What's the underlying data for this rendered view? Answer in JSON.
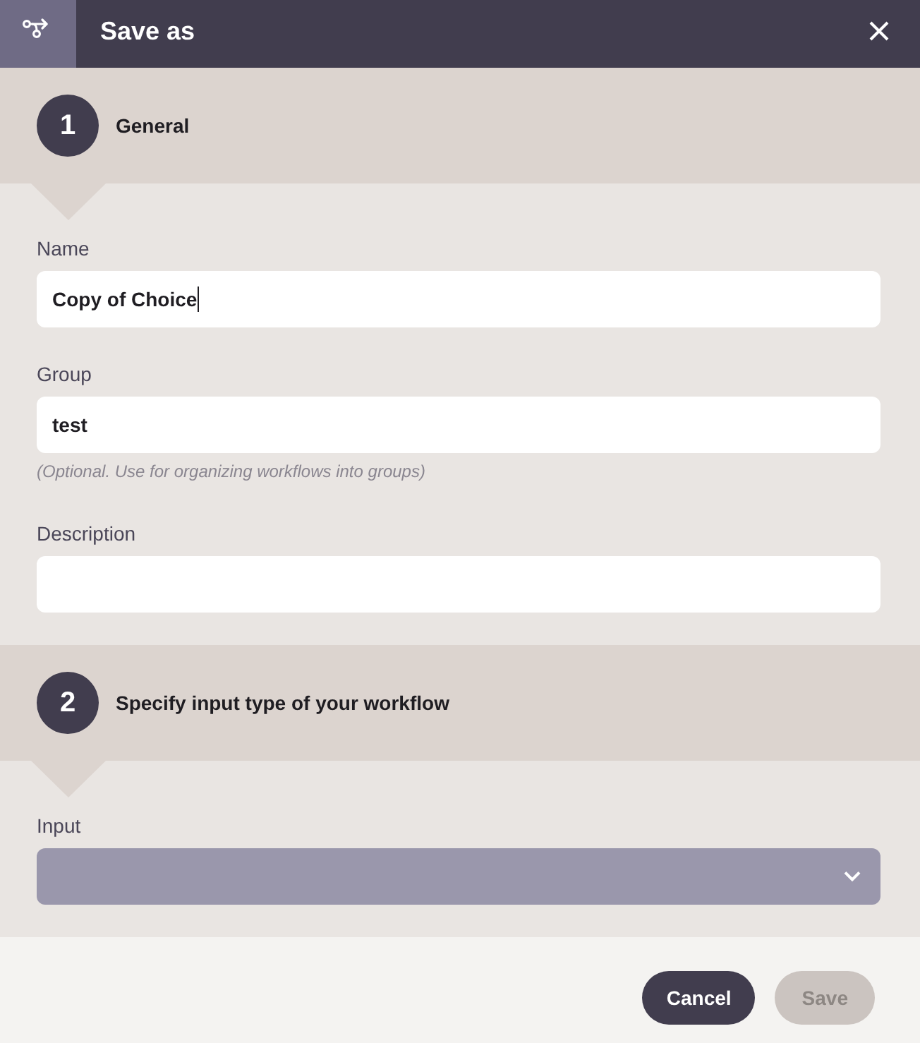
{
  "dialog": {
    "title": "Save as"
  },
  "steps": [
    {
      "number": "1",
      "title": "General",
      "fields": [
        {
          "kind": "text",
          "label": "Name",
          "value": "Copy of Choice",
          "focused": true
        },
        {
          "kind": "text",
          "label": "Group",
          "value": "test",
          "hint": "(Optional. Use for organizing workflows into groups)",
          "focused": false
        },
        {
          "kind": "text",
          "label": "Description",
          "focused": false
        }
      ]
    },
    {
      "number": "2",
      "title": "Specify input type of your workflow",
      "fields": [
        {
          "kind": "select",
          "label": "Input"
        }
      ]
    }
  ],
  "buttons": [
    {
      "label": "Cancel",
      "disabled": false
    },
    {
      "label": "Save",
      "disabled": true
    }
  ]
}
